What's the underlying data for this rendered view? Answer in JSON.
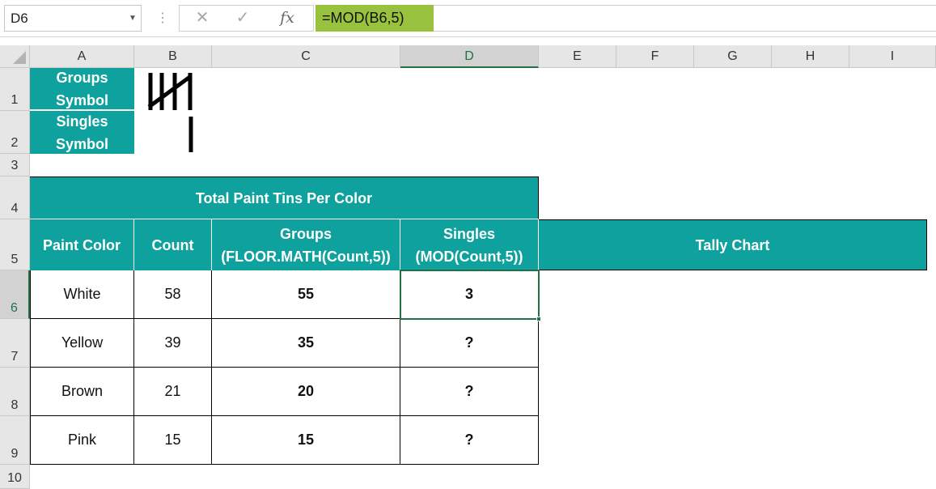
{
  "formula_bar": {
    "name_box": "D6",
    "formula": "=MOD(B6,5)",
    "cancel_glyph": "✕",
    "enter_glyph": "✓",
    "fx_glyph": "fx"
  },
  "columns": [
    "A",
    "B",
    "C",
    "D",
    "E",
    "F",
    "G",
    "H",
    "I"
  ],
  "rows": [
    "1",
    "2",
    "3",
    "4",
    "5",
    "6",
    "7",
    "8",
    "9",
    "10"
  ],
  "selected_cell": "D6",
  "legend": {
    "groups_line1": "Groups",
    "groups_line2": "Symbol",
    "singles_line1": "Singles",
    "singles_line2": "Symbol",
    "groups_icon": "tally-five-icon",
    "singles_icon": "tally-one-icon"
  },
  "table": {
    "title": "Total Paint Tins Per Color",
    "headers": {
      "paint_color": "Paint Color",
      "count": "Count",
      "groups_line1": "Groups",
      "groups_line2": "(FLOOR.MATH(Count,5))",
      "singles_line1": "Singles",
      "singles_line2": "(MOD(Count,5))",
      "tally": "Tally Chart"
    },
    "rows": [
      {
        "color": "White",
        "count": "58",
        "groups": "55",
        "singles": "3"
      },
      {
        "color": "Yellow",
        "count": "39",
        "groups": "35",
        "singles": "?"
      },
      {
        "color": "Brown",
        "count": "21",
        "groups": "20",
        "singles": "?"
      },
      {
        "color": "Pink",
        "count": "15",
        "groups": "15",
        "singles": "?"
      }
    ]
  },
  "colors": {
    "teal": "#0fa19d",
    "formula_highlight": "#98c13d",
    "excel_green": "#217346"
  }
}
